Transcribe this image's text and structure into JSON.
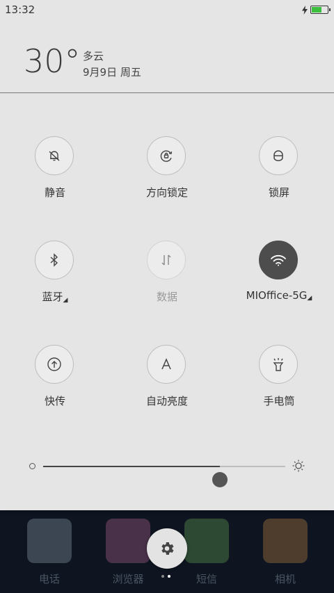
{
  "status_bar": {
    "time": "13:32",
    "battery_level": 0.7
  },
  "weather": {
    "temperature": "30°",
    "condition": "多云",
    "date": "9月9日 周五"
  },
  "quick_settings": {
    "silent": {
      "label": "静音",
      "icon": "bell-off-icon"
    },
    "rotation_lock": {
      "label": "方向锁定",
      "icon": "rotation-lock-icon"
    },
    "lock_screen": {
      "label": "锁屏",
      "icon": "lock-icon"
    },
    "bluetooth": {
      "label": "蓝牙",
      "icon": "bluetooth-icon"
    },
    "data": {
      "label": "数据",
      "icon": "data-arrows-icon"
    },
    "wifi": {
      "label": "MIOffice-5G",
      "icon": "wifi-icon"
    },
    "quick_share": {
      "label": "快传",
      "icon": "upload-icon"
    },
    "auto_brightness": {
      "label": "自动亮度",
      "icon": "auto-brightness-icon"
    },
    "flashlight": {
      "label": "手电筒",
      "icon": "flashlight-icon"
    }
  },
  "brightness": {
    "level": 0.73
  },
  "dock": {
    "apps": [
      {
        "label": "电话",
        "color": "#b4c5d6"
      },
      {
        "label": "浏览器",
        "color": "#e27bb3"
      },
      {
        "label": "短信",
        "color": "#7fcf64"
      },
      {
        "label": "相机",
        "color": "#f4a04b"
      }
    ]
  },
  "colors": {
    "battery_fill": "#3cbf3c",
    "wifi_active": "#4d4d4d"
  }
}
